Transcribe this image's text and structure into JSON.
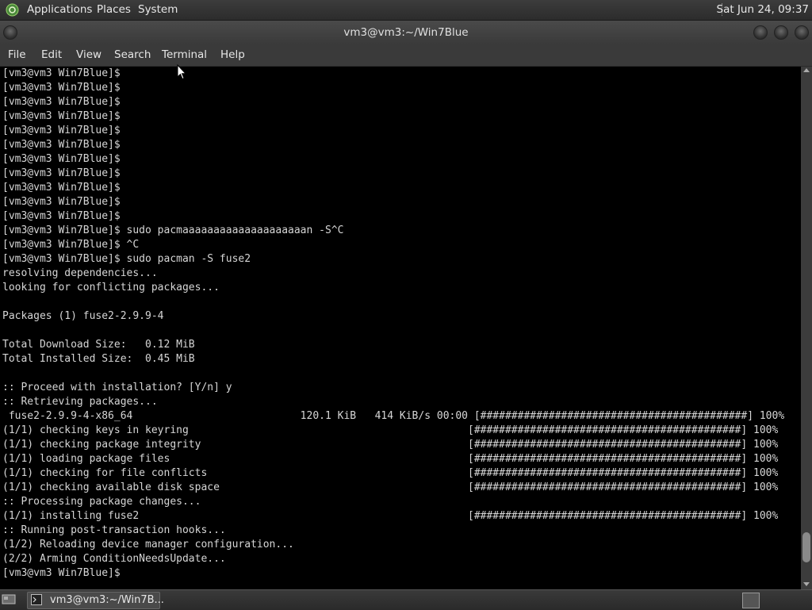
{
  "top_panel": {
    "menus": {
      "applications": "Applications",
      "places": "Places",
      "system": "System"
    },
    "clock": "Sat Jun 24, 09:37"
  },
  "window": {
    "title": "vm3@vm3:~/Win7Blue",
    "menu": {
      "file": "File",
      "edit": "Edit",
      "view": "View",
      "search": "Search",
      "terminal": "Terminal",
      "help": "Help"
    }
  },
  "terminal": {
    "lines": [
      "[vm3@vm3 Win7Blue]$",
      "[vm3@vm3 Win7Blue]$",
      "[vm3@vm3 Win7Blue]$",
      "[vm3@vm3 Win7Blue]$",
      "[vm3@vm3 Win7Blue]$",
      "[vm3@vm3 Win7Blue]$",
      "[vm3@vm3 Win7Blue]$",
      "[vm3@vm3 Win7Blue]$",
      "[vm3@vm3 Win7Blue]$",
      "[vm3@vm3 Win7Blue]$",
      "[vm3@vm3 Win7Blue]$",
      "[vm3@vm3 Win7Blue]$ sudo pacmaaaaaaaaaaaaaaaaaaaan -S^C",
      "[vm3@vm3 Win7Blue]$ ^C",
      "[vm3@vm3 Win7Blue]$ sudo pacman -S fuse2",
      "resolving dependencies...",
      "looking for conflicting packages...",
      "",
      "Packages (1) fuse2-2.9.9-4",
      "",
      "Total Download Size:   0.12 MiB",
      "Total Installed Size:  0.45 MiB",
      "",
      ":: Proceed with installation? [Y/n] y",
      ":: Retrieving packages...",
      " fuse2-2.9.9-4-x86_64                           120.1 KiB   414 KiB/s 00:00 [###########################################] 100%",
      "(1/1) checking keys in keyring                                             [###########################################] 100%",
      "(1/1) checking package integrity                                           [###########################################] 100%",
      "(1/1) loading package files                                                [###########################################] 100%",
      "(1/1) checking for file conflicts                                          [###########################################] 100%",
      "(1/1) checking available disk space                                        [###########################################] 100%",
      ":: Processing package changes...",
      "(1/1) installing fuse2                                                     [###########################################] 100%",
      ":: Running post-transaction hooks...",
      "(1/2) Reloading device manager configuration...",
      "(2/2) Arming ConditionNeedsUpdate...",
      "[vm3@vm3 Win7Blue]$"
    ],
    "scroll_position": 0.96
  },
  "taskbar": {
    "window_label": "vm3@vm3:~/Win7B..."
  },
  "icons": {
    "logo": "distro-logo-icon",
    "pointer": "mouse-pointer-icon",
    "terminal": "terminal-icon",
    "desktop": "show-desktop-icon",
    "workspace": "workspace-switcher-icon"
  }
}
